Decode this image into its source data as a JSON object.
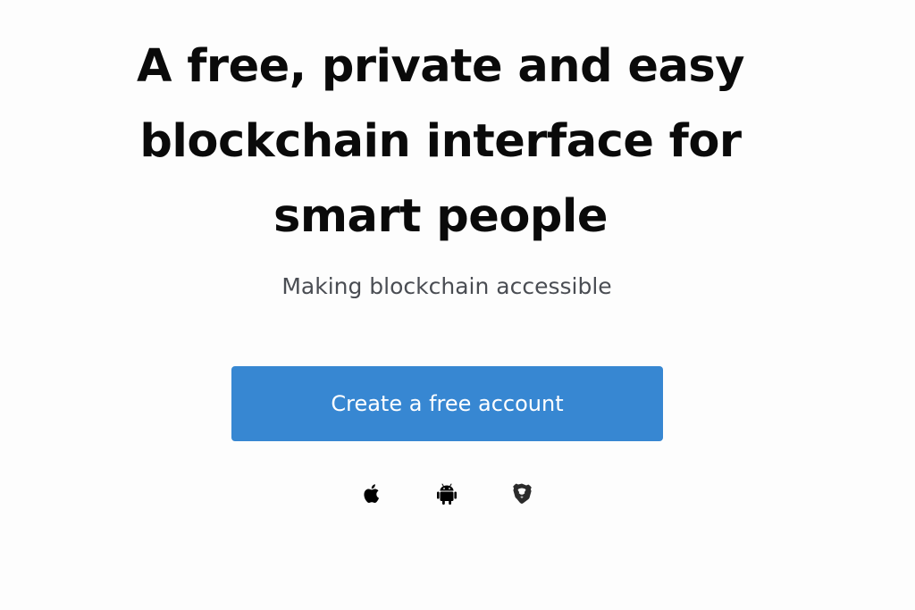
{
  "hero": {
    "headline_lines": [
      "A free, private and easy",
      "blockchain interface for",
      "smart people"
    ],
    "subtitle": "Making blockchain accessible",
    "cta_label": "Create a free account"
  },
  "platforms": [
    {
      "name": "apple-icon"
    },
    {
      "name": "android-icon"
    },
    {
      "name": "brave-icon"
    }
  ],
  "colors": {
    "background": "#fdfdfd",
    "headline": "#0a0a0a",
    "subtitle": "#4a4d53",
    "cta_background": "#3787d2",
    "cta_text": "#ffffff"
  }
}
